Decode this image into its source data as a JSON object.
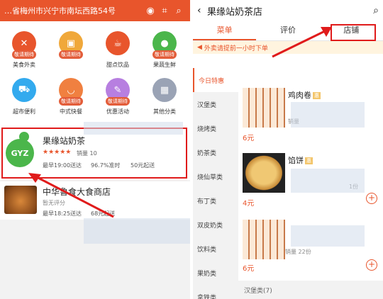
{
  "left": {
    "location": "…省梅州市兴宁市南坛西路54号",
    "categories": [
      {
        "label": "美食外卖",
        "pill": "敬请期待",
        "color": "#e8552c",
        "icon": "fork-icon"
      },
      {
        "label": "",
        "pill": "敬请期待",
        "color": "#f0a83a",
        "icon": "basket-icon"
      },
      {
        "label": "甜点饮品",
        "pill": "",
        "color": "#e8552c",
        "icon": "cup-icon"
      },
      {
        "label": "果蔬生鲜",
        "pill": "敬请期待",
        "color": "#4bb64b",
        "icon": "apple-icon"
      },
      {
        "label": "超市便利",
        "pill": "",
        "color": "#33aaee",
        "icon": "cart-icon"
      },
      {
        "label": "中式快餐",
        "pill": "敬请期待",
        "color": "#f08040",
        "icon": "bowl-icon"
      },
      {
        "label": "优惠活动",
        "pill": "敬请期待",
        "color": "#b77fe0",
        "icon": "tag-icon"
      },
      {
        "label": "其他分类",
        "pill": "",
        "color": "#9aa3b5",
        "icon": "grid-icon"
      }
    ],
    "shop1": {
      "name": "果缘站奶茶",
      "logo": "GYZ",
      "rating": "★★★★★",
      "sales": "销量 10",
      "delivery": "最早19:00送达",
      "ontime": "96.7%准时",
      "minimum": "50元起送"
    },
    "shop2": {
      "name": "中华鲁食大食商店",
      "rating_text": "暂无评分",
      "delivery": "最早18:25送达",
      "minimum": "68元起送"
    }
  },
  "right": {
    "title": "果缘站奶茶店",
    "tabs": [
      "菜单",
      "评价",
      "店铺"
    ],
    "notice": "外卖请提前一小时下单",
    "sidebar": [
      "今日特惠",
      "汉堡类",
      "烧烤类",
      "奶茶类",
      "烧仙草类",
      "布丁类",
      "双皮奶类",
      "饮料类",
      "果奶类",
      "拿铁类"
    ],
    "items": [
      {
        "name": "鸡肉卷",
        "tag": "惠",
        "sales": "销量",
        "price": "6元"
      },
      {
        "name": "馅饼",
        "tag": "惠",
        "sales": "1份",
        "price": "4元"
      },
      {
        "name": "",
        "tag": "",
        "sales": "销量 22份",
        "price": "6元"
      }
    ],
    "section": "汉堡类(7)"
  }
}
